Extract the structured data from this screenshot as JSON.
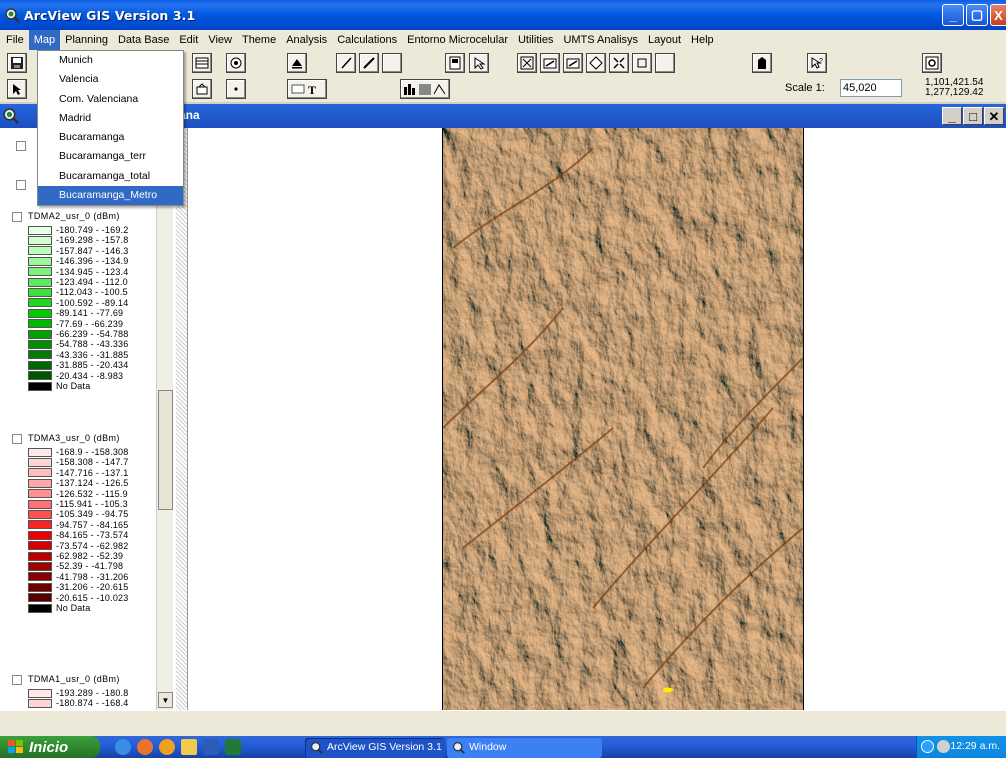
{
  "window": {
    "title": "ArcView GIS Version 3.1"
  },
  "menubar": [
    "File",
    "Map",
    "Planning",
    "Data Base",
    "Edit",
    "View",
    "Theme",
    "Analysis",
    "Calculations",
    "Entorno Microcelular",
    "Utilities",
    "UMTS Analisys",
    "Layout",
    "Help"
  ],
  "active_menu": "Map",
  "map_menu": {
    "items": [
      "Munich",
      "Valencia",
      "Com. Valenciana",
      "Madrid",
      "Bucaramanga",
      "Bucaramanga_terr",
      "Bucaramanga_total",
      "Bucaramanga_Metro"
    ],
    "selected": "Bucaramanga_Metro"
  },
  "toolbar": {
    "scale_label": "Scale 1:",
    "scale_value": "45,020",
    "coord_x": "1,101,421.54",
    "coord_y": "1,277,129.42"
  },
  "view": {
    "title_fragment": "tana"
  },
  "toc": {
    "themes": [
      {
        "name": "TDMA2_usr_0 (dBm)",
        "classes": [
          {
            "label": "-180.749 - -169.2",
            "color": "#e8ffe8"
          },
          {
            "label": "-169.298 - -157.8",
            "color": "#d0ffd0"
          },
          {
            "label": "-157.847 - -146.3",
            "color": "#b8fdb8"
          },
          {
            "label": "-146.396 - -134.9",
            "color": "#9cf79c"
          },
          {
            "label": "-134.945 - -123.4",
            "color": "#7ef07e"
          },
          {
            "label": "-123.494 - -112.0",
            "color": "#5ee85e"
          },
          {
            "label": "-112.043 - -100.5",
            "color": "#3ee03e"
          },
          {
            "label": "-100.592 - -89.14",
            "color": "#1ed81e"
          },
          {
            "label": "-89.141 - -77.69",
            "color": "#00cc00"
          },
          {
            "label": "-77.69 - -66.239",
            "color": "#00b800"
          },
          {
            "label": "-66.239 - -54.788",
            "color": "#00a400"
          },
          {
            "label": "-54.788 - -43.336",
            "color": "#009000"
          },
          {
            "label": "-43.336 - -31.885",
            "color": "#007c00"
          },
          {
            "label": "-31.885 - -20.434",
            "color": "#006800"
          },
          {
            "label": "-20.434 - -8.983",
            "color": "#005400"
          },
          {
            "label": "No Data",
            "color": "#000000"
          }
        ]
      },
      {
        "name": "TDMA3_usr_0 (dBm)",
        "classes": [
          {
            "label": "-168.9 - -158.308",
            "color": "#ffe8e8"
          },
          {
            "label": "-158.308 - -147.7",
            "color": "#ffd4d4"
          },
          {
            "label": "-147.716 - -137.1",
            "color": "#ffc0c0"
          },
          {
            "label": "-137.124 - -126.5",
            "color": "#ffa8a8"
          },
          {
            "label": "-126.532 - -115.9",
            "color": "#ff9090"
          },
          {
            "label": "-115.941 - -105.3",
            "color": "#ff7070"
          },
          {
            "label": "-105.349 - -94.75",
            "color": "#ff5050"
          },
          {
            "label": "-94.757 - -84.165",
            "color": "#ff2020"
          },
          {
            "label": "-84.165 - -73.574",
            "color": "#ee0000"
          },
          {
            "label": "-73.574 - -62.982",
            "color": "#d40000"
          },
          {
            "label": "-62.982 - -52.39",
            "color": "#bb0000"
          },
          {
            "label": "-52.39 - -41.798",
            "color": "#a00000"
          },
          {
            "label": "-41.798 - -31.206",
            "color": "#880000"
          },
          {
            "label": "-31.206 - -20.615",
            "color": "#700000"
          },
          {
            "label": "-20.615 - -10.023",
            "color": "#580000"
          },
          {
            "label": "No Data",
            "color": "#000000"
          }
        ]
      },
      {
        "name": "TDMA1_usr_0 (dBm)",
        "classes": [
          {
            "label": "-193.289 - -180.8",
            "color": "#ffe8e8"
          },
          {
            "label": "-180.874 - -168.4",
            "color": "#ffd4d4"
          }
        ]
      }
    ]
  },
  "taskbar": {
    "start_label": "Inicio",
    "tasks": [
      "ArcView GIS Version 3.1",
      "Window"
    ],
    "clock": "12:29 a.m."
  }
}
